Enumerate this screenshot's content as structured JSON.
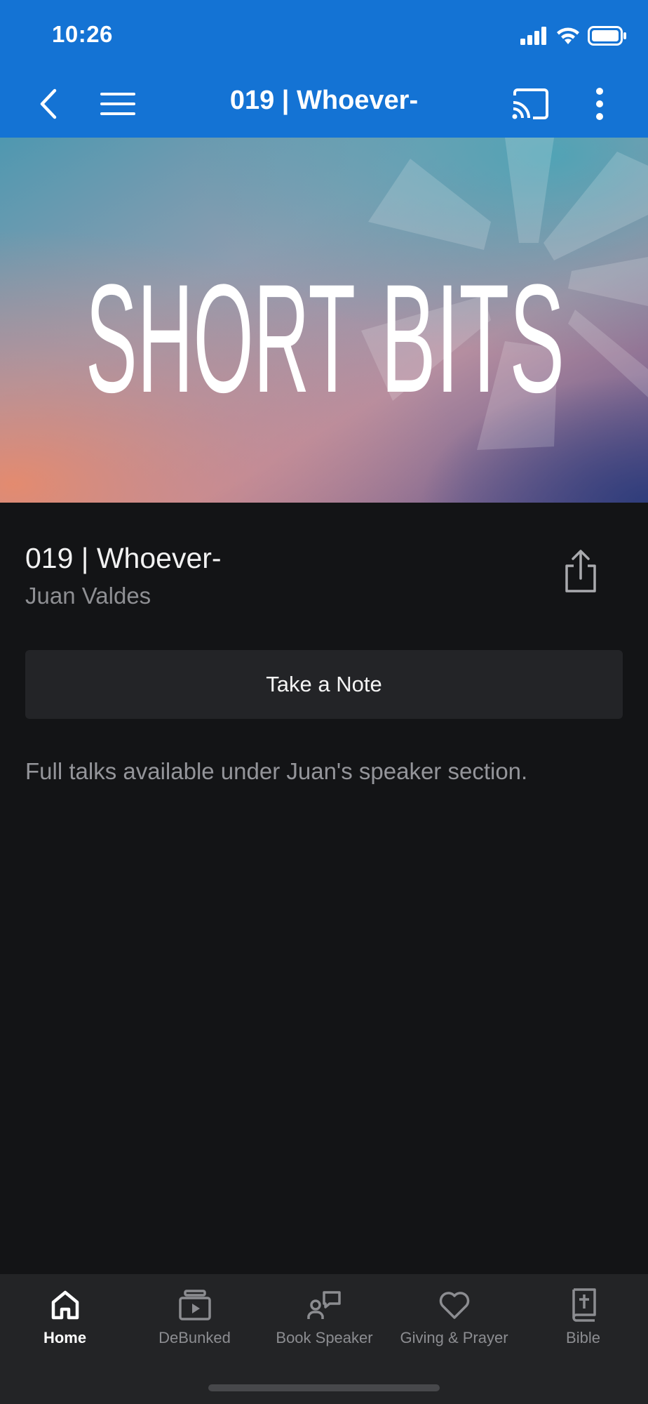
{
  "status_bar": {
    "time": "10:26"
  },
  "nav": {
    "title": "019 | Whoever-",
    "back_icon": "chevron-left-icon",
    "menu_icon": "hamburger-icon",
    "cast_icon": "cast-icon",
    "more_icon": "vertical-dots-icon"
  },
  "hero": {
    "artwork_text_1": "SHORT",
    "artwork_text_2": "BITS"
  },
  "episode": {
    "title": "019 | Whoever-",
    "speaker": "Juan Valdes",
    "share_icon": "share-icon"
  },
  "actions": {
    "take_note_label": "Take a Note"
  },
  "description": "Full talks available under Juan's speaker section.",
  "tabs": [
    {
      "label": "Home",
      "icon": "home-icon",
      "active": true
    },
    {
      "label": "DeBunked",
      "icon": "video-library-icon",
      "active": false
    },
    {
      "label": "Book Speaker",
      "icon": "speaker-chat-icon",
      "active": false
    },
    {
      "label": "Giving & Prayer",
      "icon": "heart-icon",
      "active": false
    },
    {
      "label": "Bible",
      "icon": "bible-icon",
      "active": false
    }
  ],
  "colors": {
    "accent": "#1473d4",
    "background": "#131416",
    "tab_bar": "#232426"
  }
}
